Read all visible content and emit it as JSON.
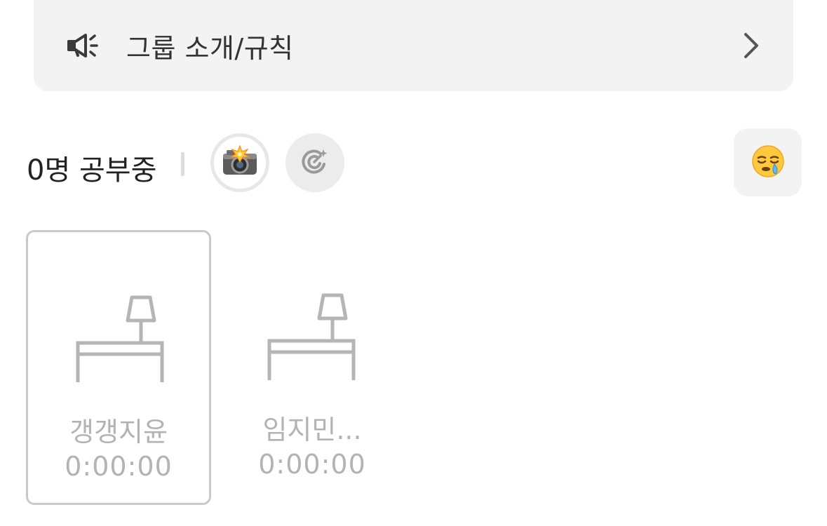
{
  "notice": {
    "label": "그룹 소개/규칙",
    "icon": "megaphone-icon",
    "arrow_icon": "chevron-right-icon"
  },
  "status": {
    "count_label": "0명 공부중",
    "camera_icon": "camera-flash-icon",
    "effect_icon": "sparkle-target-icon",
    "emoji_icon": "sleepy-face-icon"
  },
  "seats": [
    {
      "name": "갱갱지윤",
      "time": "0:00:00",
      "selected": true
    },
    {
      "name": "임지민...",
      "time": "0:00:00",
      "selected": false
    }
  ],
  "colors": {
    "banner_bg": "#f3f3f3",
    "muted_text": "#b3b3b3",
    "desk_stroke": "#b5b5b5"
  }
}
